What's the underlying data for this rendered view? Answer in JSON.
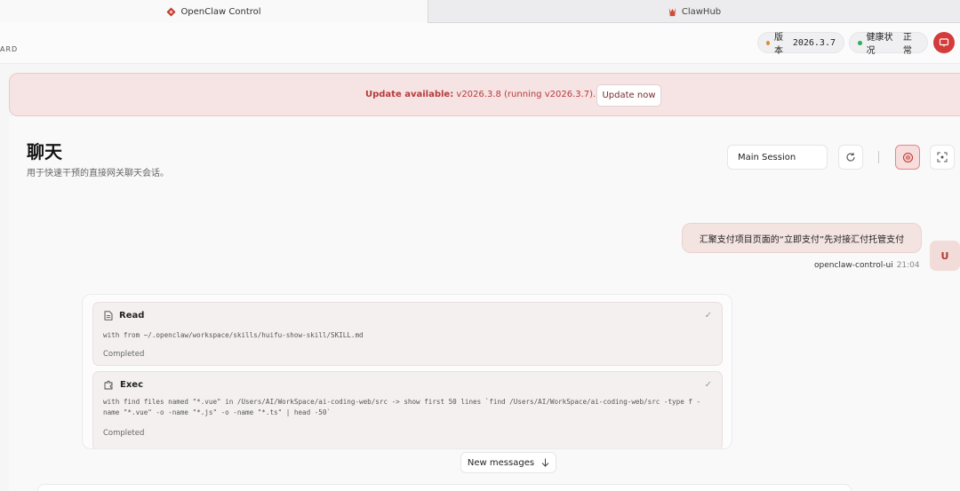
{
  "tabs": [
    {
      "label": "OpenClaw Control",
      "active": true,
      "icon": "openclaw-logo-icon"
    },
    {
      "label": "ClawHub",
      "active": false,
      "icon": "clawhub-logo-icon"
    }
  ],
  "header": {
    "brand_fragment": "ARD",
    "version_label": "版本",
    "version_value": "2026.3.7",
    "health_label": "健康状况",
    "health_value": "正常",
    "colors": {
      "version_dot": "#e08a2c",
      "health_dot": "#2fae5b",
      "accent": "#d43b3b"
    }
  },
  "banner": {
    "prefix": "Update available:",
    "message": "v2026.3.8 (running v2026.3.7).",
    "button_label": "Update now"
  },
  "page": {
    "title": "聊天",
    "subtitle": "用于快速干预的直接网关聊天会话。"
  },
  "toolbar": {
    "session_value": "Main Session",
    "icons": [
      "refresh-icon",
      "thinking-toggle-icon",
      "focus-mode-icon"
    ]
  },
  "messages": {
    "user": {
      "text": "汇聚支付项目页面的“立即支付”先对接汇付托管支付",
      "sender": "openclaw-control-ui",
      "time": "21:04",
      "avatar_letter": "U"
    },
    "tools": [
      {
        "name": "Read",
        "icon": "file-icon",
        "detail": "with from ~/.openclaw/workspace/skills/huifu-show-skill/SKILL.md",
        "status": "Completed"
      },
      {
        "name": "Exec",
        "icon": "puzzle-icon",
        "detail": "with find files named \"*.vue\" in /Users/AI/WorkSpace/ai-coding-web/src -> show first 50 lines `find /Users/AI/WorkSpace/ai-coding-web/src -type f -name \"*.vue\" -o -name \"*.js\" -o -name \"*.ts\" | head -50`",
        "status": "Completed"
      }
    ],
    "new_messages_label": "New messages"
  }
}
